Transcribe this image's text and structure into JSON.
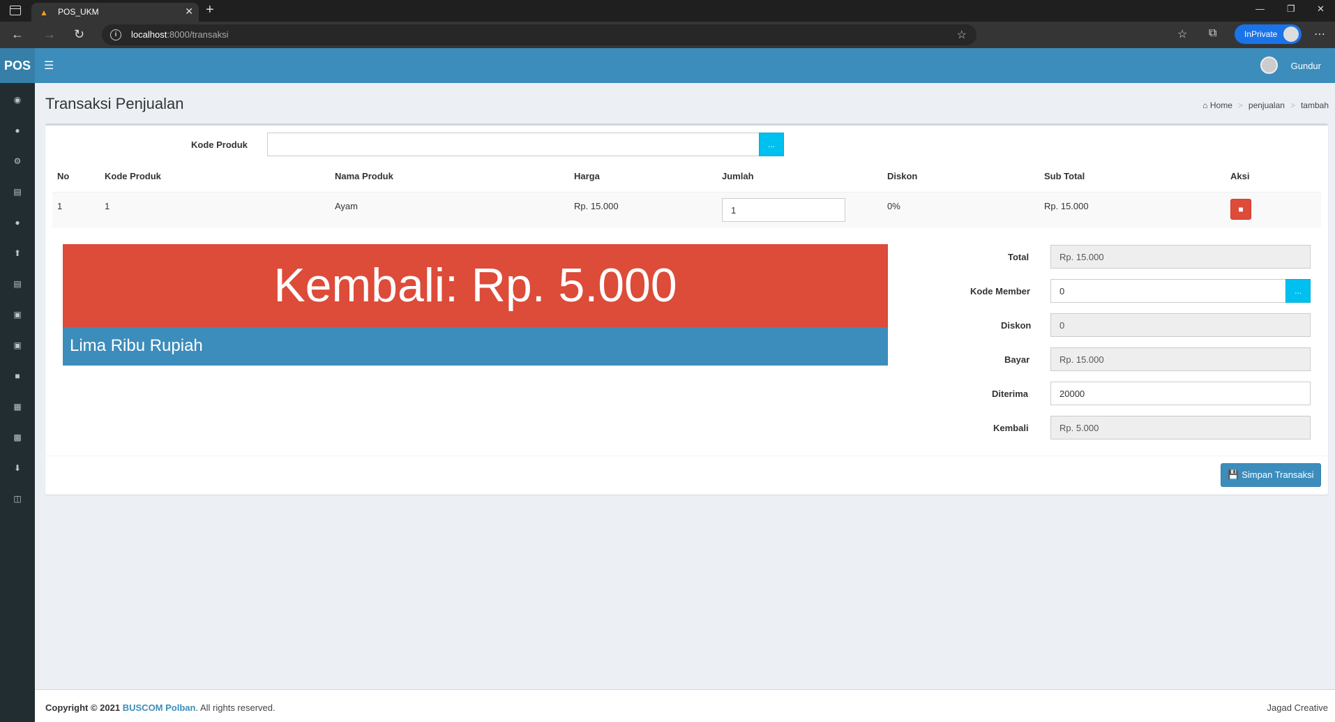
{
  "browser": {
    "tab_title": "POS_UKM",
    "url_host": "localhost",
    "url_rest": ":8000/transaksi",
    "inprivate_label": "InPrivate"
  },
  "header": {
    "logo": "POS",
    "user_name": "Gundur"
  },
  "page": {
    "title": "Transaksi Penjualan",
    "breadcrumb": [
      "Home",
      "penjualan",
      "tambah"
    ]
  },
  "form": {
    "kode_produk_label": "Kode Produk",
    "kode_produk_value": "",
    "browse_label": "..."
  },
  "table": {
    "headers": [
      "No",
      "Kode Produk",
      "Nama Produk",
      "Harga",
      "Jumlah",
      "Diskon",
      "Sub Total",
      "Aksi"
    ],
    "rows": [
      {
        "no": "1",
        "kode": "1",
        "nama": "Ayam",
        "harga": "Rp. 15.000",
        "jumlah": "1",
        "diskon": "0%",
        "subtotal": "Rp. 15.000"
      }
    ]
  },
  "display": {
    "kembali_text": "Kembali: Rp. 5.000",
    "terbilang": "Lima Ribu Rupiah"
  },
  "summary": {
    "total_label": "Total",
    "total_value": "Rp. 15.000",
    "member_label": "Kode Member",
    "member_value": "0",
    "diskon_label": "Diskon",
    "diskon_value": "0",
    "bayar_label": "Bayar",
    "bayar_value": "Rp. 15.000",
    "diterima_label": "Diterima",
    "diterima_value": "20000",
    "kembali_label": "Kembali",
    "kembali_value": "Rp. 5.000"
  },
  "actions": {
    "save_label": "Simpan Transaksi"
  },
  "footer": {
    "copyright_prefix": "Copyright © 2021",
    "org_name": "BUSCOM Polban",
    "copyright_suffix": ". All rights reserved.",
    "right_text": "Jagad Creative"
  },
  "colors": {
    "primary": "#3c8dbc",
    "danger": "#dd4b39",
    "info": "#00c0ef",
    "sidebar": "#222d32"
  },
  "sidebar_icons": [
    "dashboard-icon",
    "user-icon",
    "cogs-icon",
    "credit-card-icon",
    "user-icon",
    "upload-icon",
    "pdf-file-icon",
    "money-icon",
    "money-icon",
    "cube-icon",
    "cubes-icon",
    "truck-icon",
    "download-icon",
    "cart-icon"
  ]
}
